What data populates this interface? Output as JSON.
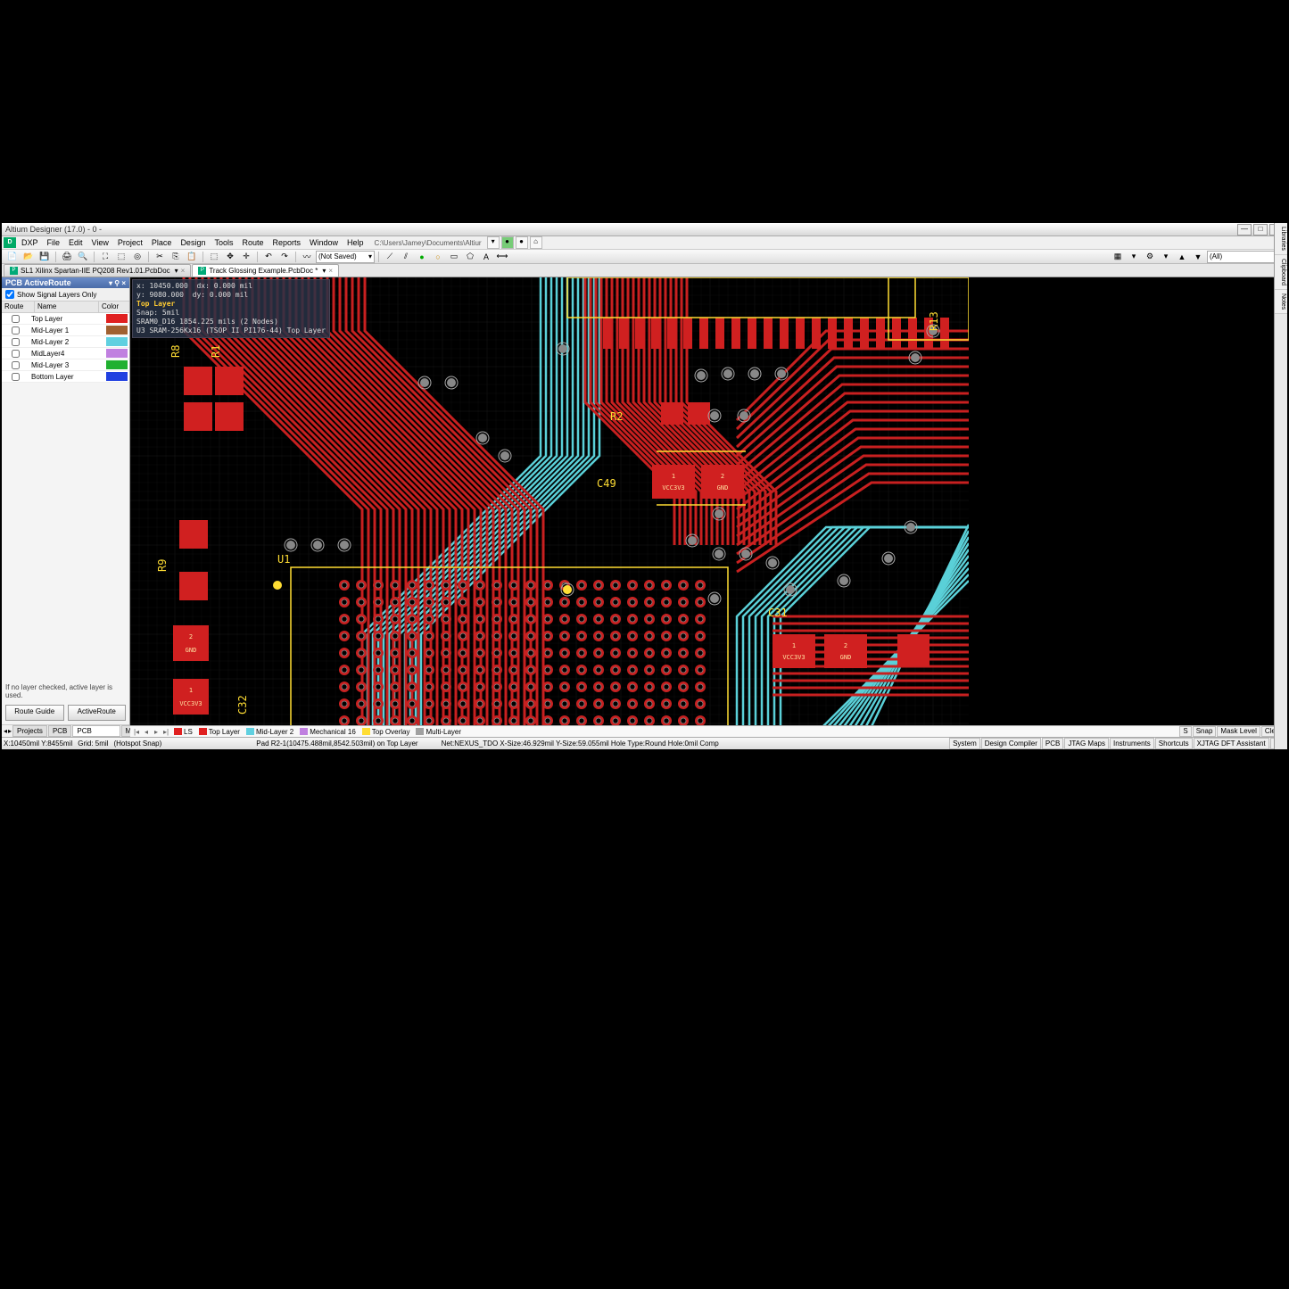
{
  "title": "Altium Designer (17.0) - 0 -",
  "menu": [
    "DXP",
    "File",
    "Edit",
    "View",
    "Project",
    "Place",
    "Design",
    "Tools",
    "Route",
    "Reports",
    "Window",
    "Help"
  ],
  "path_box": "C:\\Users\\Jamey\\Documents\\Altiur",
  "unsaved_combo": "(Not Saved)",
  "filter_text": "(All)",
  "doc_tabs": [
    {
      "label": "SL1 Xilinx Spartan-IIE PQ208 Rev1.01.PcbDoc",
      "active": false
    },
    {
      "label": "Track Glossing Example.PcbDoc *",
      "active": true
    }
  ],
  "panel": {
    "title": "PCB ActiveRoute",
    "show_signal": "Show Signal Layers Only",
    "col_route": "Route",
    "col_name": "Name",
    "col_color": "Color",
    "layers": [
      {
        "name": "Top Layer",
        "color": "#e02020"
      },
      {
        "name": "Mid-Layer 1",
        "color": "#a06030"
      },
      {
        "name": "Mid-Layer 2",
        "color": "#60d0e0"
      },
      {
        "name": "MidLayer4",
        "color": "#c080e0"
      },
      {
        "name": "Mid-Layer 3",
        "color": "#20b030"
      },
      {
        "name": "Bottom Layer",
        "color": "#2040e0"
      }
    ],
    "note": "If no layer checked, active layer is used.",
    "btn_guide": "Route Guide",
    "btn_active": "ActiveRoute",
    "bottom_tabs": [
      "Projects",
      "PCB",
      "PCB ActiveRoute",
      "Mech..."
    ]
  },
  "heads_up": {
    "x": "x: 10450.000",
    "dx": "dx:   0.000 mil",
    "y": "y:  9080.000",
    "dy": "dy:   0.000 mil",
    "layer": "Top Layer",
    "snap": "Snap: 5mil",
    "line3": "SRAM0_D16   1854.225 mils  (2 Nodes)",
    "line4": "U3  SRAM-256Kx16 (TSOP II PI176-44)  Top Layer"
  },
  "silk": {
    "R8": "R8",
    "R1": "R1",
    "R2": "R2",
    "C49": "C49",
    "R9": "R9",
    "U1": "U1",
    "C32": "C32",
    "C31": "C31",
    "R13": "R13"
  },
  "pads": {
    "vcc": "VCC3V3",
    "gnd": "GND",
    "p1": "1",
    "p2": "2"
  },
  "layer_tabs": [
    {
      "label": "LS",
      "color": "#e02020"
    },
    {
      "label": "Top Layer",
      "color": "#e02020"
    },
    {
      "label": "Mid-Layer 2",
      "color": "#60d0e0"
    },
    {
      "label": "Mechanical 16",
      "color": "#c080e0"
    },
    {
      "label": "Top Overlay",
      "color": "#ffdd33"
    },
    {
      "label": "Multi-Layer",
      "color": "#a0a0a0"
    }
  ],
  "lt_right": [
    "S",
    "Snap",
    "Mask Level",
    "Clear"
  ],
  "status": {
    "coord": "X:10450mil Y:8455mil",
    "grid": "Grid: 5mil",
    "hotspot": "(Hotspot Snap)",
    "pad": "Pad R2-1(10475.488mil,8542.503mil) on Top Layer",
    "net": "Net:NEXUS_TDO X-Size:46.929mil Y-Size:59.055mil Hole Type:Round Hole:0mil  Comp",
    "buttons": [
      "System",
      "Design Compiler",
      "PCB",
      "JTAG Maps",
      "Instruments",
      "Shortcuts",
      "XJTAG DFT Assistant",
      ">>"
    ]
  },
  "right_tabs": [
    "Libraries",
    "Clipboard",
    "Notes"
  ]
}
